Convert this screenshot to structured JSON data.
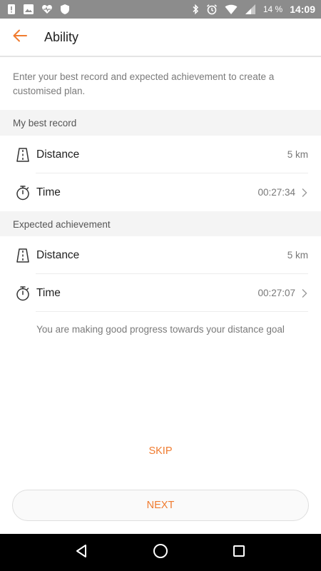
{
  "status_bar": {
    "battery_text": "14 %",
    "time": "14:09"
  },
  "header": {
    "title": "Ability",
    "accent_color": "#f07b2f"
  },
  "intro": "Enter your best record and expected achievement to create a customised plan.",
  "best_record": {
    "header": "My best record",
    "distance_label": "Distance",
    "distance_value": "5 km",
    "time_label": "Time",
    "time_value": "00:27:34"
  },
  "expected": {
    "header": "Expected achievement",
    "distance_label": "Distance",
    "distance_value": "5 km",
    "time_label": "Time",
    "time_value": "00:27:07"
  },
  "progress_message": "You are making good progress towards your distance goal",
  "actions": {
    "skip_label": "SKIP",
    "next_label": "NEXT"
  },
  "icons": [
    "back-arrow-icon",
    "road-icon",
    "stopwatch-icon",
    "chevron-right-icon"
  ]
}
